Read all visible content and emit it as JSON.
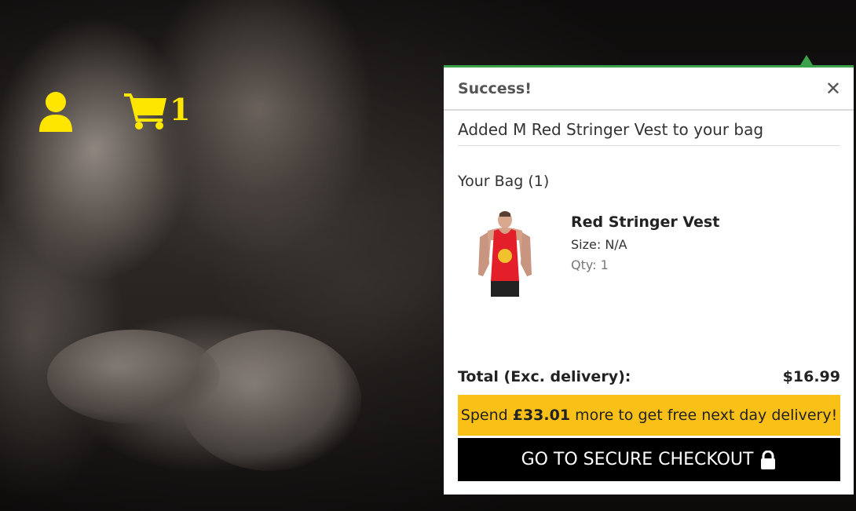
{
  "header": {
    "user_icon": "user-icon",
    "cart_icon": "cart-icon",
    "cart_count": "1",
    "accent_color": "#ffe600"
  },
  "popup": {
    "title": "Success!",
    "close_label": "✕",
    "added_message": "Added M Red Stringer Vest to your bag",
    "bag_title": "Your Bag (1)",
    "items": [
      {
        "name": "Red Stringer Vest",
        "size": "Size: N/A",
        "qty": "Qty: 1",
        "image_icon": "product-image-red-stringer-vest"
      }
    ],
    "total_label": "Total (Exc. delivery):",
    "total_value": "$16.99",
    "delivery_prefix": "Spend ",
    "delivery_amount": "£33.01",
    "delivery_suffix": " more to get free next day delivery!",
    "checkout_label": "GO TO SECURE CHECKOUT",
    "colors": {
      "success_border": "#3aa34a",
      "banner": "#f9c117",
      "checkout_bg": "#000000"
    }
  }
}
